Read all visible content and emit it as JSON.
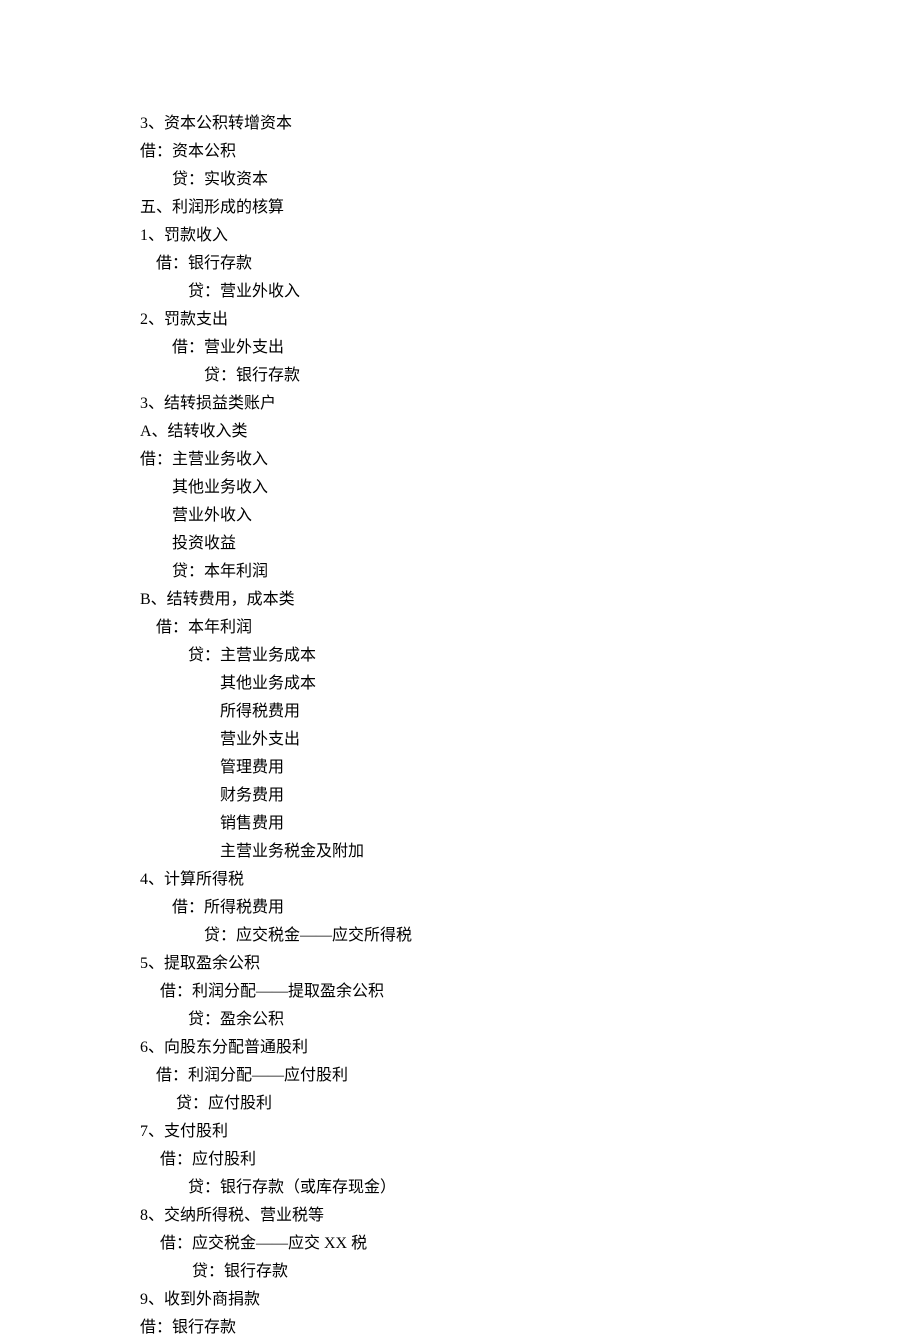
{
  "lines": [
    {
      "indent": 0,
      "text": "3、资本公积转增资本"
    },
    {
      "indent": 0,
      "text": "借：资本公积"
    },
    {
      "indent": 2,
      "text": "贷：实收资本"
    },
    {
      "indent": 0,
      "text": "五、利润形成的核算"
    },
    {
      "indent": 0,
      "text": "1、罚款收入"
    },
    {
      "indent": 1,
      "text": "借：银行存款"
    },
    {
      "indent": 3,
      "text": "贷：营业外收入"
    },
    {
      "indent": 0,
      "text": "2、罚款支出"
    },
    {
      "indent": 2,
      "text": "借：营业外支出"
    },
    {
      "indent": 4,
      "text": "贷：银行存款"
    },
    {
      "indent": 0,
      "text": "3、结转损益类账户"
    },
    {
      "indent": 0,
      "text": "A、结转收入类"
    },
    {
      "indent": 0,
      "text": "借：主营业务收入"
    },
    {
      "indent": 2,
      "text": "其他业务收入"
    },
    {
      "indent": 2,
      "text": "营业外收入"
    },
    {
      "indent": 2,
      "text": "投资收益"
    },
    {
      "indent": 2,
      "text": "贷：本年利润"
    },
    {
      "indent": 0,
      "text": "B、结转费用，成本类"
    },
    {
      "indent": 1,
      "text": "借：本年利润"
    },
    {
      "indent": 3,
      "text": "贷：主营业务成本"
    },
    {
      "indent": 5,
      "text": "其他业务成本"
    },
    {
      "indent": 5,
      "text": "所得税费用"
    },
    {
      "indent": 5,
      "text": "营业外支出"
    },
    {
      "indent": 5,
      "text": "管理费用"
    },
    {
      "indent": 5,
      "text": "财务费用"
    },
    {
      "indent": 5,
      "text": "销售费用"
    },
    {
      "indent": 5,
      "text": "主营业务税金及附加"
    },
    {
      "indent": 0,
      "text": "4、计算所得税"
    },
    {
      "indent": 2,
      "text": "借：所得税费用"
    },
    {
      "indent": 4,
      "text": "贷：应交税金——应交所得税"
    },
    {
      "indent": 0,
      "text": "5、提取盈余公积"
    },
    {
      "indent": 1.5,
      "text": "借：利润分配——提取盈余公积"
    },
    {
      "indent": 3,
      "text": "贷：盈余公积"
    },
    {
      "indent": 0,
      "text": "6、向股东分配普通股利"
    },
    {
      "indent": 1,
      "text": "借：利润分配——应付股利"
    },
    {
      "indent": 2.5,
      "text": "贷：应付股利"
    },
    {
      "indent": 0,
      "text": "7、支付股利"
    },
    {
      "indent": 1.5,
      "text": "借：应付股利"
    },
    {
      "indent": 3,
      "text": "贷：银行存款（或库存现金）"
    },
    {
      "indent": 0,
      "text": "8、交纳所得税、营业税等"
    },
    {
      "indent": 1.5,
      "text": "借：应交税金——应交 XX 税"
    },
    {
      "indent": 3.5,
      "text": "贷：银行存款"
    },
    {
      "indent": 0,
      "text": "9、收到外商捐款"
    },
    {
      "indent": 0,
      "text": "借：银行存款"
    }
  ]
}
